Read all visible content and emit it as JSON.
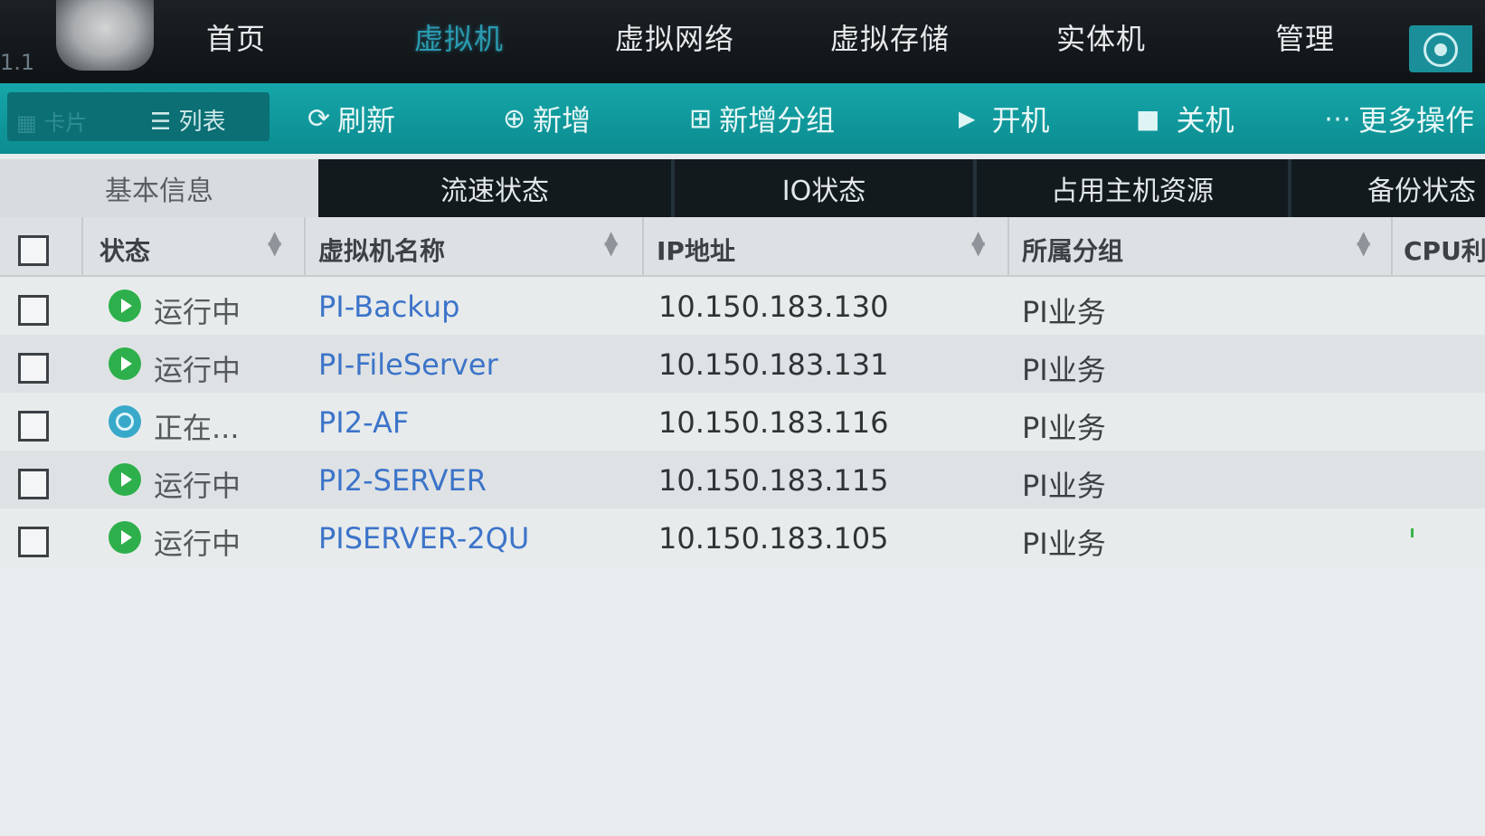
{
  "app": {
    "version": "1.1"
  },
  "nav": {
    "items": [
      {
        "label": "首页"
      },
      {
        "label": "虚拟机"
      },
      {
        "label": "虚拟网络"
      },
      {
        "label": "虚拟存储"
      },
      {
        "label": "实体机"
      },
      {
        "label": "管理"
      }
    ],
    "active_index": 1
  },
  "toolbar": {
    "view_card": "卡片",
    "view_list": "列表",
    "refresh": "刷新",
    "add": "新增",
    "add_group": "新增分组",
    "power_on": "开机",
    "power_off": "关机",
    "more": "更多操作"
  },
  "tabs": [
    {
      "label": "基本信息",
      "active": true
    },
    {
      "label": "流速状态",
      "active": false
    },
    {
      "label": "IO状态",
      "active": false
    },
    {
      "label": "占用主机资源",
      "active": false
    },
    {
      "label": "备份状态",
      "active": false
    }
  ],
  "table": {
    "columns": [
      {
        "label": "状态"
      },
      {
        "label": "虚拟机名称"
      },
      {
        "label": "IP地址"
      },
      {
        "label": "所属分组"
      },
      {
        "label": "CPU利"
      }
    ],
    "rows": [
      {
        "status": "运行中",
        "status_type": "running",
        "name": "PI-Backup",
        "ip": "10.150.183.130",
        "group": "PI业务"
      },
      {
        "status": "运行中",
        "status_type": "running",
        "name": "PI-FileServer",
        "ip": "10.150.183.131",
        "group": "PI业务"
      },
      {
        "status": "正在...",
        "status_type": "busy",
        "name": "PI2-AF",
        "ip": "10.150.183.116",
        "group": "PI业务"
      },
      {
        "status": "运行中",
        "status_type": "running",
        "name": "PI2-SERVER",
        "ip": "10.150.183.115",
        "group": "PI业务"
      },
      {
        "status": "运行中",
        "status_type": "running",
        "name": "PISERVER-2QU",
        "ip": "10.150.183.105",
        "group": "PI业务"
      }
    ]
  },
  "colors": {
    "accent": "#0b8c90",
    "link": "#3c74c9",
    "running": "#2db04b",
    "busy": "#39a9c9"
  }
}
